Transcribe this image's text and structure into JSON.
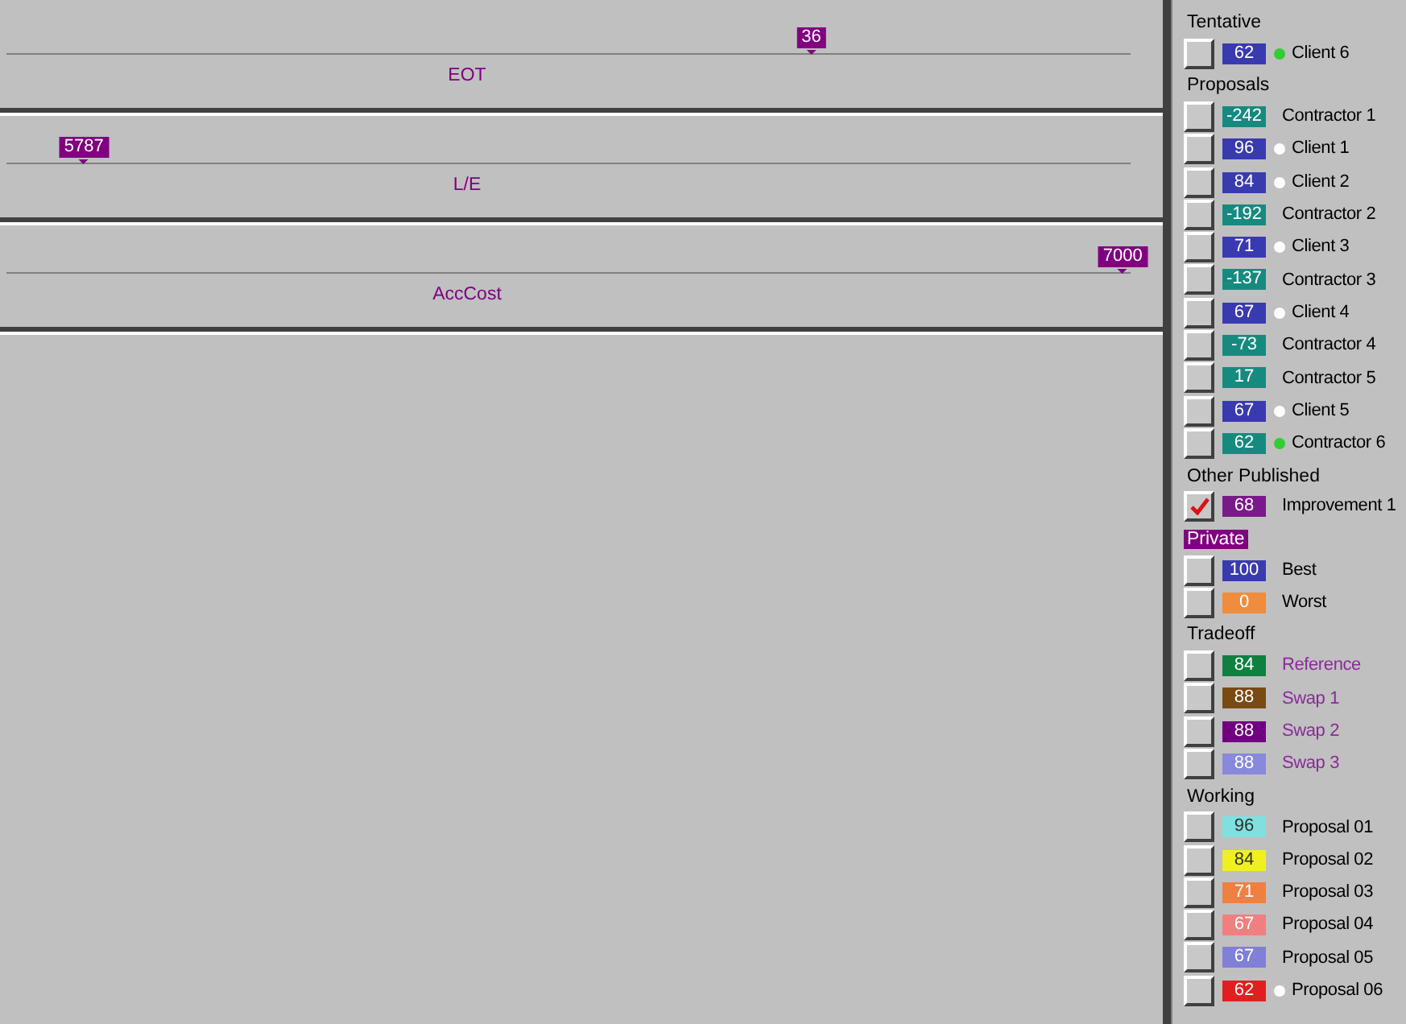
{
  "tracks": [
    {
      "label": "EOT",
      "marker": "36",
      "level": 0.716
    },
    {
      "label": "L/E",
      "marker": "5787",
      "level": 0.069
    },
    {
      "label": "AccCost",
      "marker": "7000",
      "level": 0.993
    }
  ],
  "groups": [
    {
      "title": "Tentative",
      "highlighted": false,
      "kind": "plain",
      "items": [
        {
          "value": "62",
          "color": "#3a3ab0",
          "dot": {
            "color": "#33cc33"
          },
          "label": "Client 6",
          "checked": false
        }
      ]
    },
    {
      "title": "Proposals",
      "highlighted": false,
      "kind": "plain",
      "items": [
        {
          "value": "-242",
          "color": "#178a80",
          "label": "Contractor 1",
          "checked": false
        },
        {
          "value": "96",
          "color": "#3a3ab0",
          "dot": {
            "color": "#ffffff"
          },
          "label": "Client 1",
          "checked": false
        },
        {
          "value": "84",
          "color": "#3a3ab0",
          "dot": {
            "color": "#ffffff"
          },
          "label": "Client 2",
          "checked": false
        },
        {
          "value": "-192",
          "color": "#178a80",
          "label": "Contractor 2",
          "checked": false
        },
        {
          "value": "71",
          "color": "#3a3ab0",
          "dot": {
            "color": "#ffffff"
          },
          "label": "Client 3",
          "checked": false
        },
        {
          "value": "-137",
          "color": "#178a80",
          "label": "Contractor 3",
          "checked": false
        },
        {
          "value": "67",
          "color": "#3a3ab0",
          "dot": {
            "color": "#ffffff"
          },
          "label": "Client 4",
          "checked": false
        },
        {
          "value": "-73",
          "color": "#178a80",
          "label": "Contractor 4",
          "checked": false
        },
        {
          "value": "17",
          "color": "#178a80",
          "label": "Contractor 5",
          "checked": false
        },
        {
          "value": "67",
          "color": "#3a3ab0",
          "dot": {
            "color": "#ffffff"
          },
          "label": "Client 5",
          "checked": false
        },
        {
          "value": "62",
          "color": "#178a80",
          "dot": {
            "color": "#33cc33"
          },
          "label": "Contractor 6",
          "checked": false
        }
      ]
    },
    {
      "title": "Other Published",
      "highlighted": false,
      "kind": "plain",
      "items": [
        {
          "value": "68",
          "color": "#7a1a8a",
          "label": "Improvement 1",
          "checked": true
        }
      ]
    },
    {
      "title": "Private",
      "highlighted": true,
      "kind": "plain",
      "items": [
        {
          "value": "100",
          "color": "#3a3ab0",
          "label": "Best",
          "checked": false
        },
        {
          "value": "0",
          "color": "#f08c3c",
          "label": "Worst",
          "checked": false
        }
      ]
    },
    {
      "title": "Tradeoff",
      "highlighted": false,
      "kind": "tradeoff",
      "items": [
        {
          "value": "84",
          "color": "#0f8040",
          "label": "Reference",
          "checked": false
        },
        {
          "value": "88",
          "color": "#7a4a14",
          "label": "Swap 1",
          "checked": false
        },
        {
          "value": "88",
          "color": "#700080",
          "label": "Swap 2",
          "checked": false
        },
        {
          "value": "88",
          "color": "#8888dd",
          "label": "Swap 3",
          "checked": false
        }
      ]
    },
    {
      "title": "Working",
      "highlighted": false,
      "kind": "plain",
      "items": [
        {
          "value": "96",
          "color": "#80e0e0",
          "label": "Proposal 01",
          "checked": false
        },
        {
          "value": "84",
          "color": "#f0f020",
          "label": "Proposal 02",
          "checked": false
        },
        {
          "value": "71",
          "color": "#f08040",
          "label": "Proposal 03",
          "checked": false
        },
        {
          "value": "67",
          "color": "#f08080",
          "label": "Proposal 04",
          "checked": false
        },
        {
          "value": "67",
          "color": "#8080d8",
          "label": "Proposal 05",
          "checked": false
        },
        {
          "value": "62",
          "color": "#e02020",
          "dot": {
            "color": "#ffffff"
          },
          "label": "Proposal 06",
          "checked": false
        }
      ]
    }
  ]
}
